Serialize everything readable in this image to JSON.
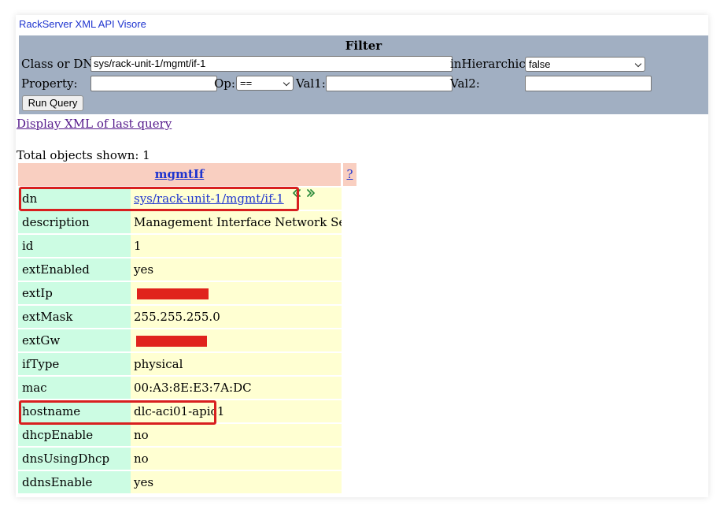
{
  "page": {
    "title": "RackServer XML API Visore"
  },
  "filter": {
    "heading": "Filter",
    "class_label": "Class or DN:",
    "class_value": "sys/rack-unit-1/mgmt/if-1",
    "hier_label": "inHierarchical",
    "hier_value": "false",
    "property_label": "Property:",
    "property_value": "",
    "op_label": "Op:",
    "op_value": "==",
    "val1_label": "Val1:",
    "val1_value": "",
    "val2_label": "Val2:",
    "val2_value": "",
    "run_label": "Run Query"
  },
  "display_xml_link": "Display XML of last query",
  "total_text": "Total objects shown: 1",
  "object": {
    "class_name": "mgmtIf",
    "help": "?",
    "rows": [
      {
        "key": "dn",
        "value": "sys/rack-unit-1/mgmt/if-1"
      },
      {
        "key": "description",
        "value": "Management Interface Network Settings"
      },
      {
        "key": "id",
        "value": "1"
      },
      {
        "key": "extEnabled",
        "value": "yes"
      },
      {
        "key": "extIp",
        "value": ""
      },
      {
        "key": "extMask",
        "value": "255.255.255.0"
      },
      {
        "key": "extGw",
        "value": ""
      },
      {
        "key": "ifType",
        "value": "physical"
      },
      {
        "key": "mac",
        "value": "00:A3:8E:E3:7A:DC"
      },
      {
        "key": "hostname",
        "value": "dlc-aci01-apic1"
      },
      {
        "key": "dhcpEnable",
        "value": "no"
      },
      {
        "key": "dnsUsingDhcp",
        "value": "no"
      },
      {
        "key": "ddnsEnable",
        "value": "yes"
      }
    ]
  },
  "colors": {
    "filter_bg": "#a1afc2",
    "header_bg": "#f9cfc1",
    "key_bg": "#ccfce3",
    "value_bg": "#ffffd2",
    "link": "#1f35cf",
    "highlight": "#d81f1f",
    "redaction": "#e0231c"
  },
  "icons": {
    "dn_prev": "chevron-left-double-icon",
    "dn_next": "chevron-right-double-icon"
  }
}
